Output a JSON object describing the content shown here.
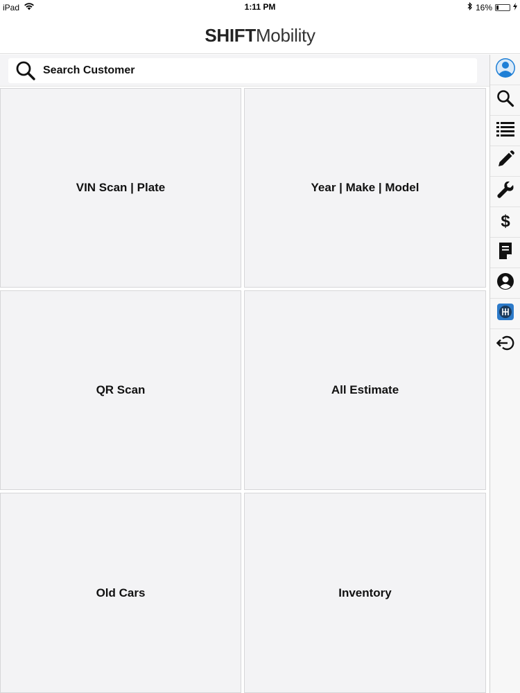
{
  "status_bar": {
    "device": "iPad",
    "time": "1:11 PM",
    "battery": "16%",
    "battery_level": 0.16
  },
  "header": {
    "brand_bold": "SHIFT",
    "brand_light": "Mobility"
  },
  "search": {
    "placeholder": "Search Customer"
  },
  "tiles": [
    {
      "label": "VIN Scan | Plate"
    },
    {
      "label": "Year | Make | Model"
    },
    {
      "label": "QR Scan"
    },
    {
      "label": "All Estimate"
    },
    {
      "label": "Old Cars"
    },
    {
      "label": "Inventory"
    }
  ],
  "sidebar": {
    "icons": [
      "user-avatar-icon",
      "search-icon",
      "list-icon",
      "pencil-icon",
      "wrench-icon",
      "dollar-icon",
      "document-icon",
      "account-circle-icon",
      "gear-shift-icon",
      "logout-icon"
    ]
  },
  "colors": {
    "tile_bg": "#f3f3f5",
    "tile_border": "#d6d6d8",
    "avatar_blue": "#1e7fd6",
    "gearshift_blue": "#2c7ac9"
  }
}
